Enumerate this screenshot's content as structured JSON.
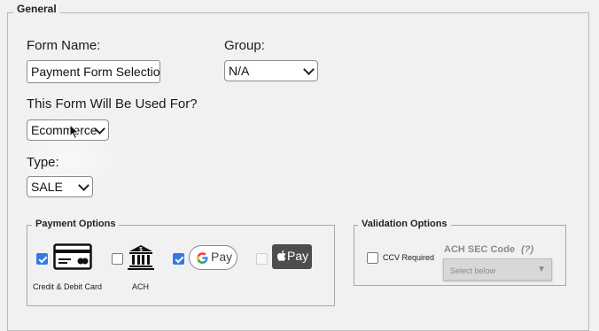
{
  "general": {
    "legend": "General",
    "form_name_label": "Form Name:",
    "form_name_value": "Payment Form Selection",
    "group_label": "Group:",
    "group_value": "N/A",
    "usage_label": "This Form Will Be Used For?",
    "usage_value": "Ecommerce",
    "type_label": "Type:",
    "type_value": "SALE"
  },
  "payment_options": {
    "legend": "Payment Options",
    "credit_debit": {
      "label": "Credit & Debit Card",
      "checked": true
    },
    "ach": {
      "label": "ACH",
      "checked": false
    },
    "google_pay": {
      "label": "Pay",
      "checked": true
    },
    "apple_pay": {
      "label": "Pay",
      "checked": false,
      "disabled": true
    }
  },
  "validation_options": {
    "legend": "Validation Options",
    "ccv_label": "CCV Required",
    "ccv_checked": false,
    "ach_sec_label": "ACH SEC Code",
    "ach_sec_help": "(?)",
    "ach_sec_value": "Select below"
  },
  "colors": {
    "background": "#f1f1f1",
    "checkbox_checked": "#3478e5",
    "apple_pay_bg": "#4d4d4d"
  }
}
